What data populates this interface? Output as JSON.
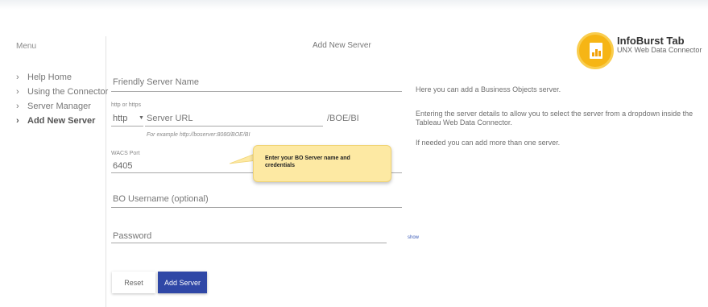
{
  "sidebar": {
    "title": "Menu",
    "items": [
      {
        "label": "Help Home",
        "active": false
      },
      {
        "label": "Using the Connector",
        "active": false
      },
      {
        "label": "Server Manager",
        "active": false
      },
      {
        "label": "Add New Server",
        "active": true
      }
    ]
  },
  "header": {
    "title": "Add New Server",
    "brand_name": "InfoBurst Tab",
    "brand_subtitle": "UNX Web Data Connector"
  },
  "form": {
    "friendly_name_placeholder": "Friendly Server Name",
    "protocol_label": "http or https",
    "protocol_value": "http",
    "server_url_placeholder": "Server URL",
    "server_url_suffix": "/BOE/BI",
    "server_url_hint": "For example http://boserver:8080/BOE/BI",
    "wacs_port_label": "WACS Port",
    "wacs_port_value": "6405",
    "username_placeholder": "BO Username (optional)",
    "password_placeholder": "Password",
    "show_link": "show"
  },
  "info": {
    "line1": "Here you can add a Business Objects server.",
    "line2": "Entering the server details to allow you to select the server from a dropdown inside the Tableau Web Data Connector.",
    "line3": "If needed you can add more than one server."
  },
  "callout": {
    "text": "Enter your BO Server name and credentials"
  },
  "buttons": {
    "reset": "Reset",
    "add_server": "Add Server"
  },
  "colors": {
    "accent": "#2f47a6",
    "logo": "#f6b515",
    "callout": "#fde9a3"
  }
}
